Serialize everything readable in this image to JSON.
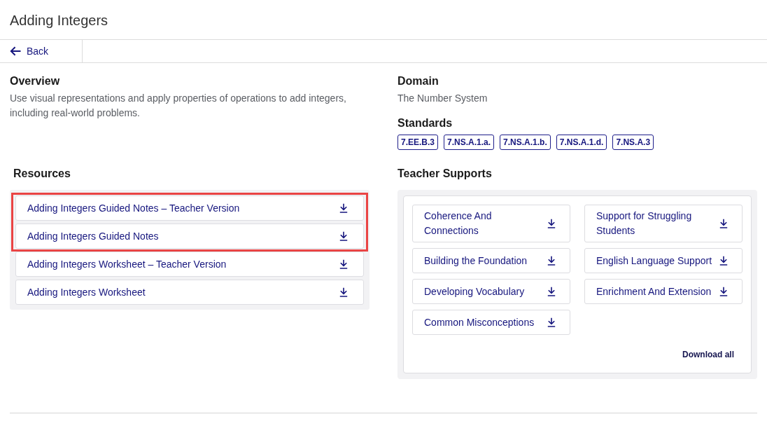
{
  "page": {
    "title": "Adding Integers"
  },
  "nav": {
    "back": "Back"
  },
  "overview": {
    "heading": "Overview",
    "text": "Use visual representations and apply properties of operations to add integers, including real-world problems."
  },
  "domain": {
    "heading": "Domain",
    "text": "The Number System"
  },
  "standards": {
    "heading": "Standards",
    "tags": [
      "7.EE.B.3",
      "7.NS.A.1.a.",
      "7.NS.A.1.b.",
      "7.NS.A.1.d.",
      "7.NS.A.3"
    ]
  },
  "resources": {
    "heading": "Resources",
    "items": [
      {
        "label": "Adding Integers Guided Notes – Teacher Version",
        "highlighted": true
      },
      {
        "label": "Adding Integers Guided Notes",
        "highlighted": true
      },
      {
        "label": "Adding Integers Worksheet – Teacher Version",
        "highlighted": false
      },
      {
        "label": "Adding Integers Worksheet",
        "highlighted": false
      }
    ]
  },
  "teacher_supports": {
    "heading": "Teacher Supports",
    "items": [
      {
        "label": "Coherence And Connections"
      },
      {
        "label": "Support for Struggling Students"
      },
      {
        "label": "Building the Foundation"
      },
      {
        "label": "English Language Support"
      },
      {
        "label": "Developing Vocabulary"
      },
      {
        "label": "Enrichment And Extension"
      },
      {
        "label": "Common Misconceptions"
      }
    ],
    "download_all": "Download all"
  }
}
